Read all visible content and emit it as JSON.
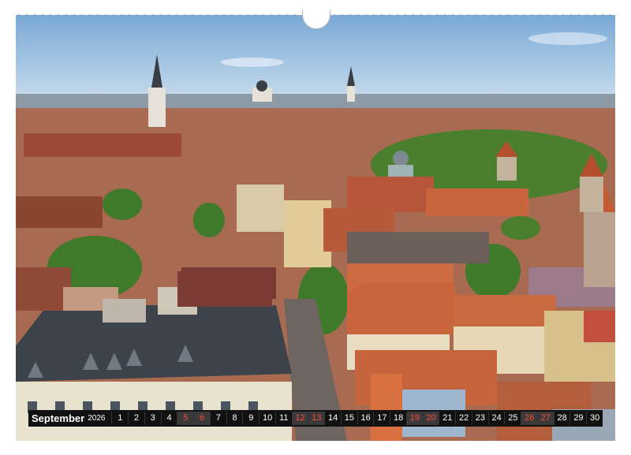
{
  "calendar": {
    "month": "September",
    "year": "2026",
    "days": [
      "1",
      "2",
      "3",
      "4",
      "5",
      "6",
      "7",
      "8",
      "9",
      "10",
      "11",
      "12",
      "13",
      "14",
      "15",
      "16",
      "17",
      "18",
      "19",
      "20",
      "21",
      "22",
      "23",
      "24",
      "25",
      "26",
      "27",
      "28",
      "29",
      "30"
    ],
    "weekend_days": [
      "5",
      "6",
      "12",
      "13",
      "19",
      "20",
      "26",
      "27"
    ]
  },
  "photo": {
    "subject": "aerial view of old town rooftops",
    "colors": {
      "sky": "#9cc3e8",
      "roof": "#b8583a",
      "slate": "#3c434a",
      "trees": "#3f7a2a"
    }
  }
}
